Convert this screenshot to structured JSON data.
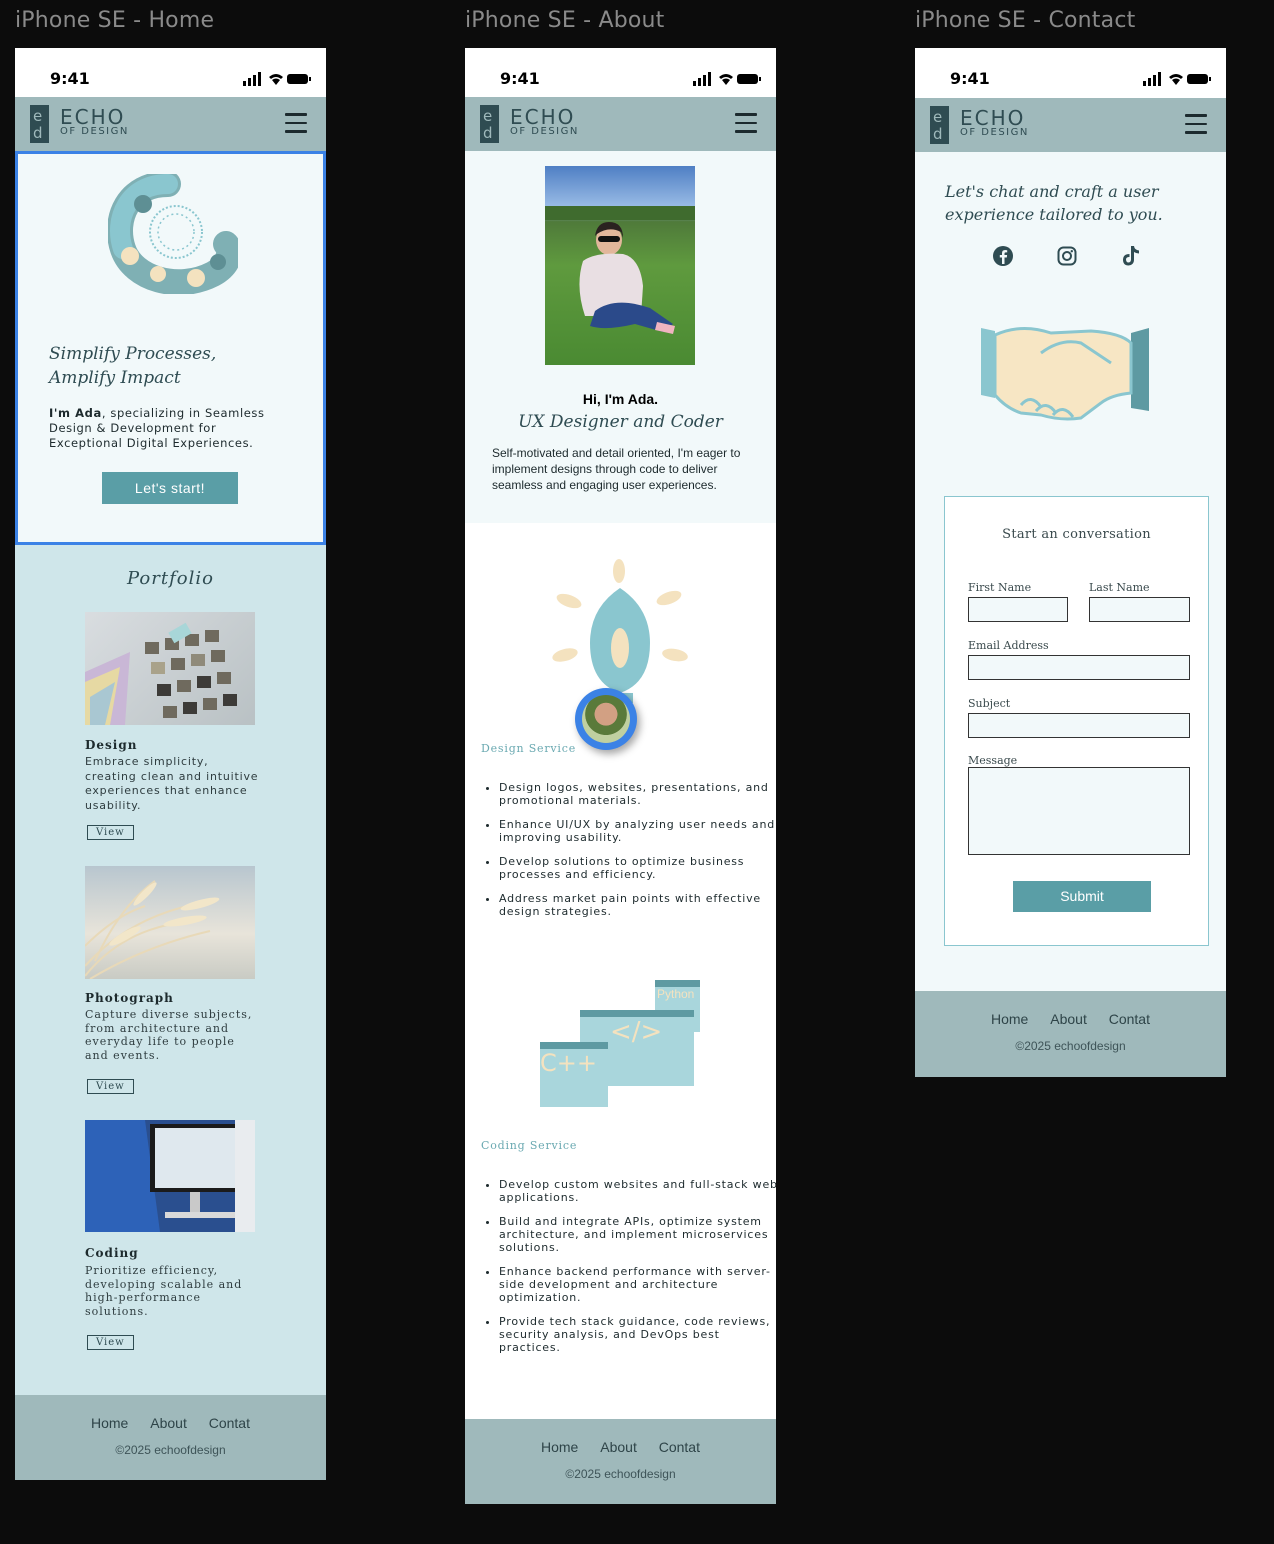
{
  "frames": {
    "home_title": "iPhone SE - Home",
    "about_title": "iPhone SE - About",
    "contact_title": "iPhone SE - Contact"
  },
  "status": {
    "time": "9:41"
  },
  "brand": {
    "name": "ECHO",
    "sub": "OF DESIGN"
  },
  "home": {
    "headline_1": "Simplify Processes,",
    "headline_2": "Amplify Impact",
    "intro_name": "I'm Ada",
    "intro_rest": ", specializing in Seamless Design & Development for Exceptional Digital Experiences.",
    "cta_label": "Let's start!",
    "portfolio_title": "Portfolio",
    "items": [
      {
        "title": "Design",
        "desc": "Embrace simplicity, creating clean and intuitive experiences that enhance usability.",
        "view": "View"
      },
      {
        "title": "Photograph",
        "desc": "Capture diverse subjects, from architecture and everyday life to people and events.",
        "view": "View"
      },
      {
        "title": "Coding",
        "desc": "Prioritize efficiency, developing scalable and high-performance solutions.",
        "view": "View"
      }
    ]
  },
  "about": {
    "greeting": "Hi, I'm Ada.",
    "role": "UX Designer and Coder",
    "bio": "Self-motivated and detail oriented, I'm eager to implement designs through code to deliver seamless and engaging user experiences.",
    "design_label": "Design Service",
    "design_points": [
      "Design logos, websites, presentations, and promotional materials.",
      "Enhance UI/UX by analyzing user needs and improving usability.",
      "Develop solutions to optimize business processes and efficiency.",
      "Address market pain points with effective design strategies."
    ],
    "code_window_python": "Python",
    "code_window_tag": "</>",
    "code_window_cpp": "C++",
    "coding_label": "Coding Service",
    "coding_points": [
      "Develop custom websites and full-stack web applications.",
      "Build and integrate APIs, optimize system architecture, and implement microservices solutions.",
      "Enhance backend performance with server-side development and architecture optimization.",
      "Provide tech stack guidance, code reviews, security analysis, and DevOps best practices."
    ]
  },
  "contact": {
    "tagline": "Let's chat and craft a user experience tailored to you.",
    "socials": [
      "facebook-icon",
      "instagram-icon",
      "tiktok-icon"
    ],
    "form_title": "Start an conversation",
    "first_name": "First Name",
    "last_name": "Last Name",
    "email": "Email Address",
    "subject": "Subject",
    "message": "Message",
    "submit": "Submit"
  },
  "footer": {
    "home": "Home",
    "about": "About",
    "contact": "Contat",
    "copyright": "©2025 echoofdesign"
  },
  "colors": {
    "header": "#9fb9bb",
    "accent": "#5a9ea6",
    "teal_dark": "#2f4c52",
    "light_bg": "#f2f9fa",
    "portfolio_bg": "#cfe6ea",
    "selection": "#3b82e6"
  }
}
